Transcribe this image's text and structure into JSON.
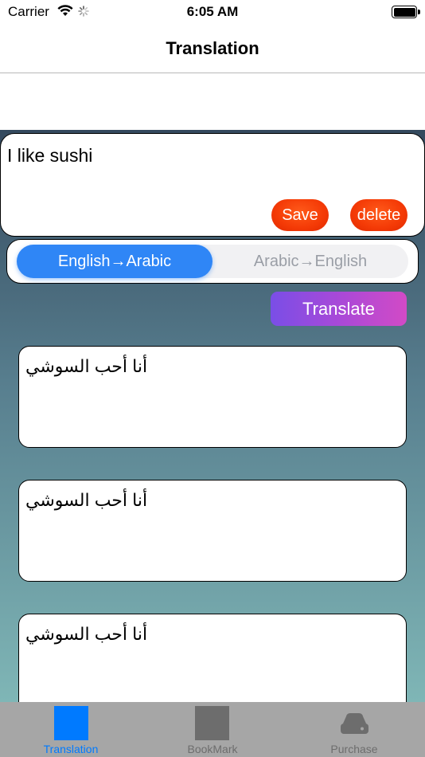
{
  "status_bar": {
    "carrier": "Carrier",
    "time": "6:05 AM"
  },
  "nav": {
    "title": "Translation"
  },
  "input": {
    "text": "I like sushi",
    "save_label": "Save",
    "delete_label": "delete"
  },
  "direction": {
    "options": [
      "English→Arabic",
      "Arabic→English"
    ],
    "selected": "English→Arabic"
  },
  "translate_label": "Translate",
  "results": [
    "أنا أحب السوشي",
    "أنا أحب السوشي",
    "أنا أحب السوشي"
  ],
  "tabs": [
    {
      "label": "Translation",
      "icon": "square-icon",
      "active": true
    },
    {
      "label": "BookMark",
      "icon": "square-icon",
      "active": false
    },
    {
      "label": "Purchase",
      "icon": "drive-icon",
      "active": false
    }
  ],
  "colors": {
    "accent": "#2f86f6",
    "tab_active": "#007aff",
    "tab_inactive": "#6d6d6d",
    "button_red": "#f43a06",
    "translate_start": "#7a4ee6",
    "translate_end": "#d24ac6"
  }
}
